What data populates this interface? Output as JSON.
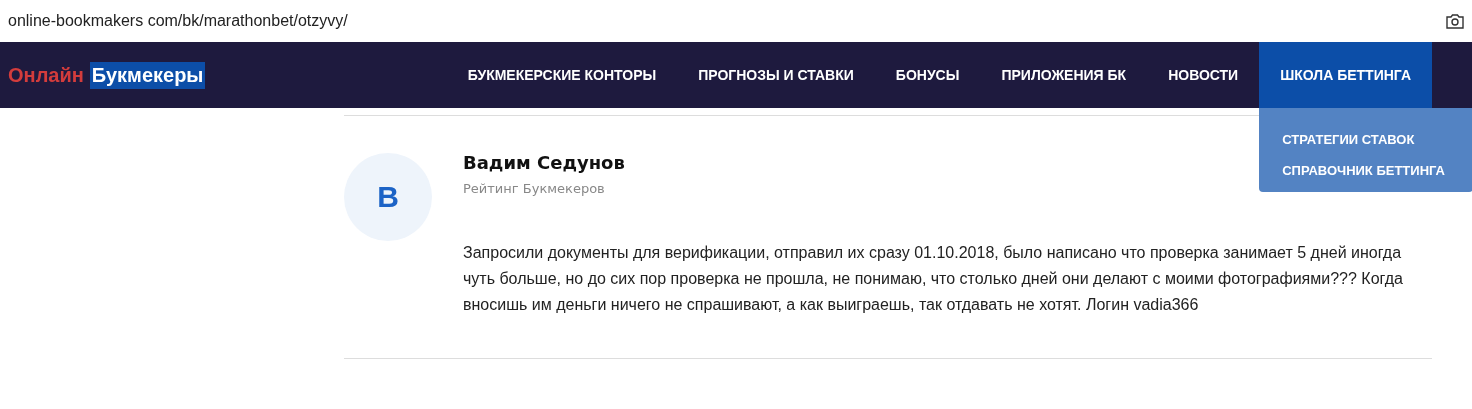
{
  "address_bar": {
    "url": "online-bookmakers com/bk/marathonbet/otzyvy/"
  },
  "logo": {
    "first_word": "Онлайн",
    "second_word": "Букмекеры"
  },
  "nav": [
    {
      "label": "БУКМЕКЕРСКИЕ КОНТОРЫ",
      "selected": false
    },
    {
      "label": "ПРОГНОЗЫ И СТАВКИ",
      "selected": false
    },
    {
      "label": "БОНУСЫ",
      "selected": false
    },
    {
      "label": "ПРИЛОЖЕНИЯ БК",
      "selected": false
    },
    {
      "label": "НОВОСТИ",
      "selected": false
    },
    {
      "label": "ШКОЛА БЕТТИНГА",
      "selected": true,
      "submenu": [
        "СТРАТЕГИИ СТАВОК",
        "СПРАВОЧНИК БЕТТИНГА"
      ]
    }
  ],
  "review": {
    "avatar_letter": "В",
    "author": "Вадим Седунов",
    "source": "Рейтинг Букмекеров",
    "text": "Запросили документы для верификации, отправил их сразу 01.10.2018, было написано что проверка занимает 5 дней иногда чуть больше, но до сих пор проверка не прошла, не понимаю, что столько дней они делают с моими фотографиями??? Когда вносишь им деньги ничего не спрашивают, а как выиграешь, так отдавать не хотят. Логин vadia366"
  }
}
